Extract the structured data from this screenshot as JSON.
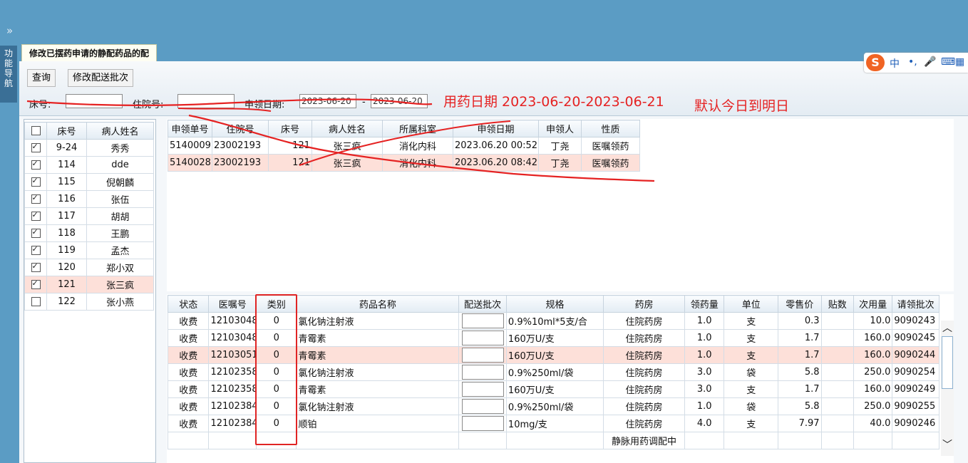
{
  "window": {
    "collapse_glyph": "»",
    "side_tab": [
      "功",
      "能",
      "导",
      "航"
    ]
  },
  "tab": {
    "title": "修改已摆药申请的静配药品的配"
  },
  "toolbar": {
    "query_button": "查询",
    "modify_batch_button": "修改配送批次",
    "bed_label": "床号:",
    "bed_value": "",
    "admission_label": "住院号:",
    "admission_value": "",
    "apply_date_label": "申领日期:",
    "date_from": "2023-06-20",
    "date_sep": "-",
    "date_to": "2023-06-20"
  },
  "annotations": {
    "note1": "用药日期 2023-06-20-2023-06-21",
    "note2": "默认今日到明日"
  },
  "ime": {
    "logo": "S",
    "items": [
      "中",
      "•,",
      "🎤",
      "⌨",
      "▦"
    ]
  },
  "patients": {
    "headers": [
      "",
      "床号",
      "病人姓名"
    ],
    "rows": [
      {
        "checked": true,
        "bed": "9-24",
        "name": "秀秀"
      },
      {
        "checked": true,
        "bed": "114",
        "name": "dde"
      },
      {
        "checked": true,
        "bed": "115",
        "name": "倪朝麟"
      },
      {
        "checked": true,
        "bed": "116",
        "name": "张伍"
      },
      {
        "checked": true,
        "bed": "117",
        "name": "胡胡"
      },
      {
        "checked": true,
        "bed": "118",
        "name": "王鹏"
      },
      {
        "checked": true,
        "bed": "119",
        "name": "孟杰"
      },
      {
        "checked": true,
        "bed": "120",
        "name": "郑小双"
      },
      {
        "checked": true,
        "bed": "121",
        "name": "张三疯",
        "selected": true
      },
      {
        "checked": false,
        "bed": "122",
        "name": "张小燕"
      }
    ]
  },
  "applications": {
    "headers": [
      "申领单号",
      "住院号",
      "床号",
      "病人姓名",
      "所属科室",
      "申领日期",
      "申领人",
      "性质"
    ],
    "rows": [
      [
        "5140009",
        "23002193",
        "121",
        "张三疯",
        "消化内科",
        "2023.06.20 00:52",
        "丁尧",
        "医嘱领药"
      ],
      [
        "5140028",
        "23002193",
        "121",
        "张三疯",
        "消化内科",
        "2023.06.20 08:42",
        "丁尧",
        "医嘱领药"
      ]
    ],
    "selected_index": 1
  },
  "drugs": {
    "headers": [
      "状态",
      "医嘱号",
      "类别",
      "药品名称",
      "配送批次",
      "规格",
      "药房",
      "领药量",
      "单位",
      "零售价",
      "贴数",
      "次用量",
      "请领批次"
    ],
    "rows": [
      [
        "收费",
        "12103048",
        "0",
        "氯化钠注射液",
        "",
        "0.9%10ml*5支/合",
        "住院药房",
        "1.0",
        "支",
        "0.3",
        "",
        "10.0",
        "9090243"
      ],
      [
        "收费",
        "12103048",
        "0",
        "青霉素",
        "",
        "160万U/支",
        "住院药房",
        "1.0",
        "支",
        "1.7",
        "",
        "160.0",
        "9090245"
      ],
      [
        "收费",
        "12103051",
        "0",
        "青霉素",
        "",
        "160万U/支",
        "住院药房",
        "1.0",
        "支",
        "1.7",
        "",
        "160.0",
        "9090244"
      ],
      [
        "收费",
        "12102358",
        "0",
        "氯化钠注射液",
        "",
        "0.9%250ml/袋",
        "住院药房",
        "3.0",
        "袋",
        "5.8",
        "",
        "250.0",
        "9090254"
      ],
      [
        "收费",
        "12102358",
        "0",
        "青霉素",
        "",
        "160万U/支",
        "住院药房",
        "3.0",
        "支",
        "1.7",
        "",
        "160.0",
        "9090249"
      ],
      [
        "收费",
        "12102384",
        "0",
        "氯化钠注射液",
        "",
        "0.9%250ml/袋",
        "住院药房",
        "1.0",
        "袋",
        "5.8",
        "",
        "250.0",
        "9090255"
      ],
      [
        "收费",
        "12102384",
        "0",
        "顺铂",
        "",
        "10mg/支",
        "住院药房",
        "4.0",
        "支",
        "7.97",
        "",
        "40.0",
        "9090246"
      ],
      [
        "",
        "",
        "",
        "",
        "",
        "",
        "静脉用药调配中",
        "",
        "",
        "",
        "",
        "",
        ""
      ]
    ],
    "selected_index": 2
  },
  "scrollbar": {
    "up": "︿",
    "down": "﹀"
  }
}
